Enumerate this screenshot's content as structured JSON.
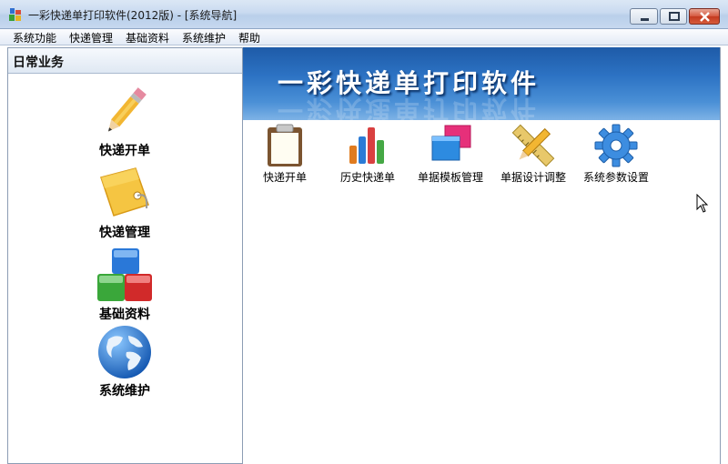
{
  "window": {
    "title": "一彩快递单打印软件(2012版) - [系统导航]"
  },
  "menu": [
    "系统功能",
    "快递管理",
    "基础资料",
    "系统维护",
    "帮助"
  ],
  "left_panel": {
    "title": "日常业务",
    "items": [
      {
        "label": "快递开单",
        "icon": "pencil-icon"
      },
      {
        "label": "快递管理",
        "icon": "tag-icon"
      },
      {
        "label": "基础资料",
        "icon": "cubes-icon"
      },
      {
        "label": "系统维护",
        "icon": "globe-icon"
      }
    ]
  },
  "banner": {
    "title": "一彩快递单打印软件"
  },
  "tiles": [
    {
      "label": "快递开单",
      "icon": "clipboard-icon"
    },
    {
      "label": "历史快递单",
      "icon": "bar-chart-icon"
    },
    {
      "label": "单据模板管理",
      "icon": "windows-icon"
    },
    {
      "label": "单据设计调整",
      "icon": "pencil-ruler-icon"
    },
    {
      "label": "系统参数设置",
      "icon": "gear-icon"
    }
  ],
  "colors": {
    "banner": "#2d73c4",
    "titlebar": "#c9daf0",
    "close_button": "#c33a20"
  }
}
